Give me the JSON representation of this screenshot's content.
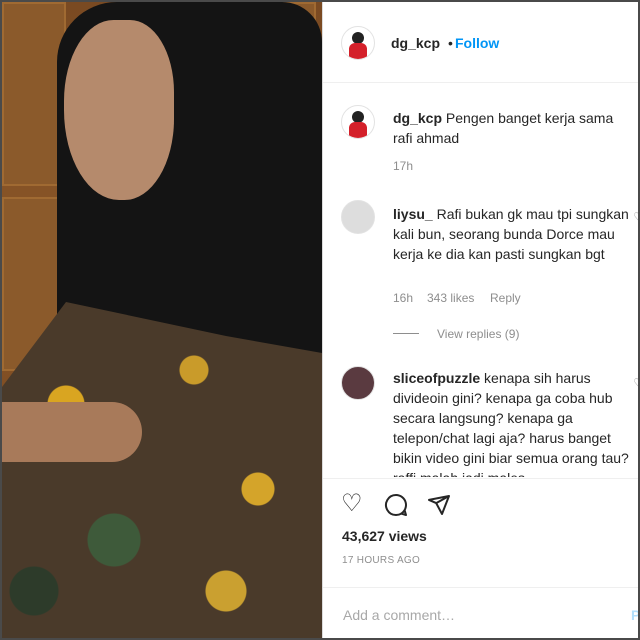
{
  "header": {
    "username": "dg_kcp",
    "separator": "•",
    "follow_label": "Follow"
  },
  "comments": [
    {
      "username": "dg_kcp",
      "text": "Pengen banget kerja sama rafi ahmad",
      "time": "17h"
    },
    {
      "username": "liysu_",
      "text": "Rafi bukan gk mau tpi sungkan kali bun, seorang bunda Dorce mau kerja ke dia kan pasti sungkan bgt",
      "time": "16h",
      "likes": "343 likes",
      "reply_label": "Reply",
      "view_replies": "View replies (9)"
    },
    {
      "username": "sliceofpuzzle",
      "text": "kenapa sih harus divideoin gini? kenapa ga coba hub secara langsung? kenapa ga telepon/chat lagi aja? harus banget bikin video gini biar semua orang tau? raffi malah jadi males"
    }
  ],
  "actions": {
    "icons": [
      "heart-icon",
      "comment-icon",
      "share-icon",
      "bookmark-icon"
    ],
    "views": "43,627 views",
    "time_ago": "17 HOURS AGO"
  },
  "add_comment": {
    "placeholder": "Add a comment…",
    "post_label": "Post"
  },
  "colors": {
    "accent": "#0095f6",
    "text": "#262626",
    "muted": "#8e8e8e"
  }
}
